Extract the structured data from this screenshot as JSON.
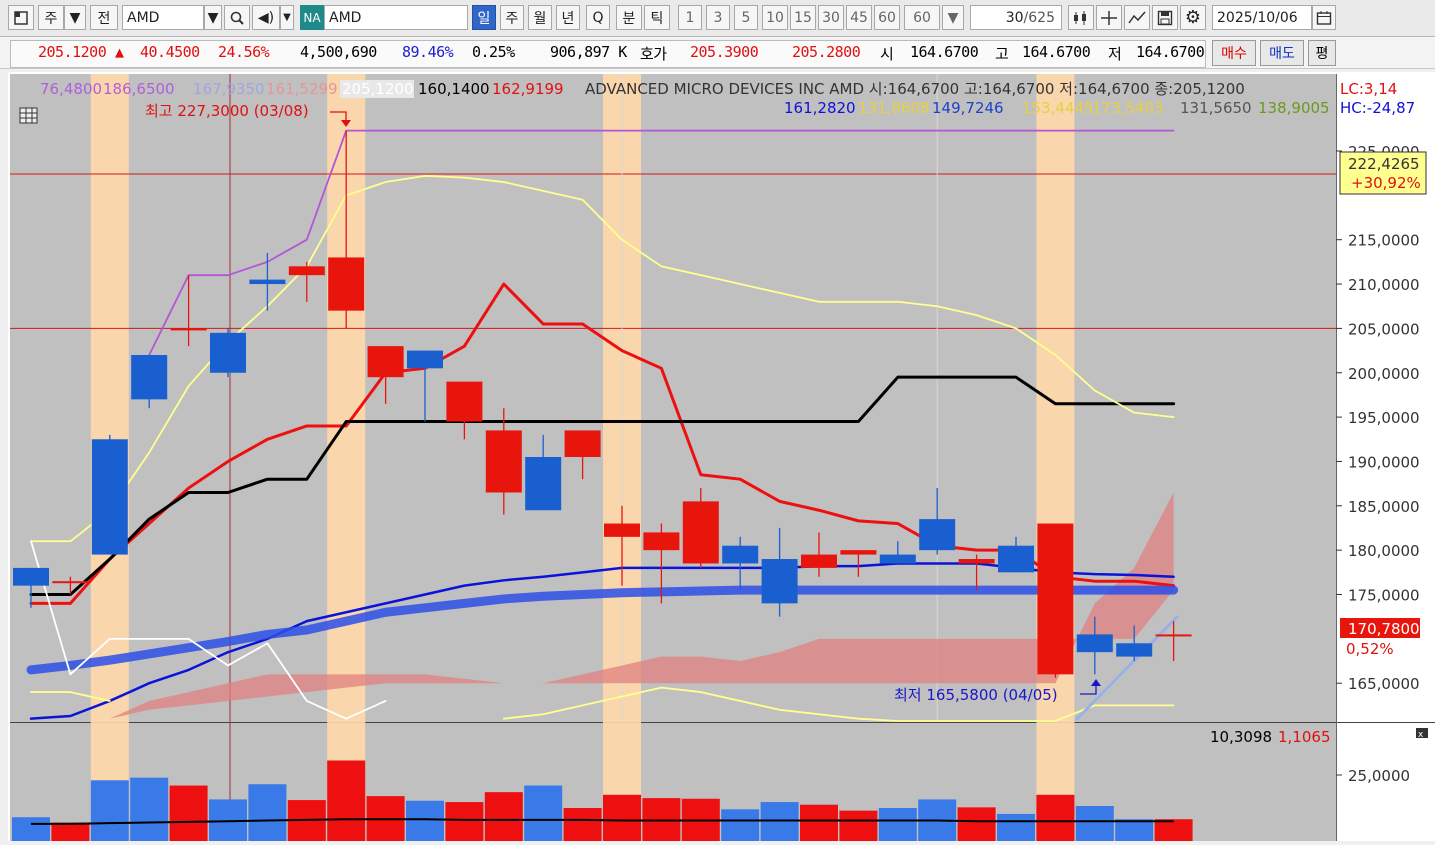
{
  "toolbar": {
    "period_label": "주",
    "prev_label": "전",
    "symbol_value": "AMD",
    "market_badge": "NA",
    "symbol_name": "AMD",
    "periods": [
      "일",
      "주",
      "월",
      "년",
      "Q"
    ],
    "active_period": "일",
    "intraday": [
      "분",
      "틱"
    ],
    "intervals": [
      "1",
      "3",
      "5",
      "10",
      "15",
      "30",
      "45",
      "60",
      "60"
    ],
    "count_value": "30",
    "count_total": "/625",
    "date_value": "2025/10/06",
    "icons": [
      "window-icon",
      "dropdown-icon",
      "search-icon",
      "speaker-icon",
      "candle-icon",
      "crosshair-icon",
      "line-tool-icon",
      "save-icon",
      "gear-icon",
      "calendar-icon"
    ]
  },
  "quote": {
    "price": "205.1200",
    "change_arrow": "▲",
    "change": "40.4500",
    "change_pct": "24.56%",
    "volume": "4,500,690",
    "volume_ratio": "89.46%",
    "turnover": "0.25%",
    "amount": "906,897 K",
    "bid_label": "호가",
    "ask_price": "205.3900",
    "bid_price": "205.2800",
    "open_label": "시",
    "open": "164.6700",
    "high_label": "고",
    "high": "164.6700",
    "low_label": "저",
    "low": "164.6700",
    "buy_label": "매수",
    "sell_label": "매도",
    "flat_label": "평"
  },
  "legend": {
    "row1": [
      "76,4800",
      "186,6500",
      "167,9350",
      "161,5299",
      "205,1200",
      "160,1400",
      "162,9199"
    ],
    "title": "ADVANCED MICRO DEVICES INC  AMD 시:164,6700 고:164,6700 저:164,6700 종:205,1200",
    "row2": [
      "161,2820",
      "131,8608",
      "149,7246",
      "153,4445",
      "173,5403",
      "131,5650",
      "138,9005"
    ],
    "lc": "LC:3,14",
    "hc": "HC:-24,87"
  },
  "annotations": {
    "max_label": "최고 227,3000 (03/08)",
    "min_label": "최저 165,5800 (04/05)",
    "top_box_value": "222,4265",
    "top_box_pct": "+30,92%",
    "current_value": "170,7800",
    "current_pct": "0,52%",
    "volume_values": [
      "10,3098",
      "1,1065"
    ]
  },
  "colors": {
    "up": "#e8150c",
    "down": "#1a5fd0",
    "highlight": "#ffd8a8",
    "ma_red": "#ee1010",
    "ma_black": "#000000",
    "ma_blue": "#0a14d8",
    "ma_yellow": "#ffff90",
    "ma_purple": "#b455d8",
    "cloud": "#e08080",
    "background": "#c0c0c0"
  },
  "chart_data": {
    "type": "candlestick",
    "ylim": [
      161,
      232
    ],
    "price_ticks": [
      "225,0000",
      "215,0000",
      "210,0000",
      "205,0000",
      "200,0000",
      "195,0000",
      "190,0000",
      "185,0000",
      "180,0000",
      "175,0000",
      "165,0000"
    ],
    "volume_ticks": [
      "25,0000"
    ],
    "hlines": [
      205.0,
      222.4
    ],
    "highlight_bars": [
      2,
      8,
      15,
      26
    ],
    "candles": [
      {
        "o": 178.0,
        "h": 178.0,
        "l": 173.5,
        "c": 176.0
      },
      {
        "o": 176.5,
        "h": 177.0,
        "l": 175.0,
        "c": 176.5
      },
      {
        "o": 192.5,
        "h": 193.0,
        "l": 179.5,
        "c": 179.5
      },
      {
        "o": 202.0,
        "h": 202.0,
        "l": 196.0,
        "c": 197.0
      },
      {
        "o": 205.0,
        "h": 211.0,
        "l": 203.0,
        "c": 205.0
      },
      {
        "o": 204.5,
        "h": 205.0,
        "l": 199.5,
        "c": 200.0
      },
      {
        "o": 210.5,
        "h": 213.5,
        "l": 207.0,
        "c": 210.0
      },
      {
        "o": 211.0,
        "h": 212.5,
        "l": 208.0,
        "c": 212.0
      },
      {
        "o": 207.0,
        "h": 227.3,
        "l": 205.0,
        "c": 213.0
      },
      {
        "o": 199.5,
        "h": 203.0,
        "l": 196.5,
        "c": 203.0
      },
      {
        "o": 202.5,
        "h": 202.5,
        "l": 194.5,
        "c": 200.5
      },
      {
        "o": 194.5,
        "h": 199.0,
        "l": 192.5,
        "c": 199.0
      },
      {
        "o": 186.5,
        "h": 196.0,
        "l": 184.0,
        "c": 193.5
      },
      {
        "o": 190.5,
        "h": 193.0,
        "l": 184.5,
        "c": 184.5
      },
      {
        "o": 190.5,
        "h": 193.0,
        "l": 188.0,
        "c": 193.5
      },
      {
        "o": 181.5,
        "h": 185.0,
        "l": 176.0,
        "c": 183.0
      },
      {
        "o": 180.0,
        "h": 183.0,
        "l": 174.0,
        "c": 182.0
      },
      {
        "o": 178.5,
        "h": 187.0,
        "l": 178.0,
        "c": 185.5
      },
      {
        "o": 180.5,
        "h": 181.5,
        "l": 175.5,
        "c": 178.5
      },
      {
        "o": 179.0,
        "h": 182.5,
        "l": 172.5,
        "c": 174.0
      },
      {
        "o": 178.0,
        "h": 182.0,
        "l": 177.0,
        "c": 179.5
      },
      {
        "o": 179.5,
        "h": 180.0,
        "l": 177.0,
        "c": 180.0
      },
      {
        "o": 179.5,
        "h": 181.0,
        "l": 178.5,
        "c": 178.5
      },
      {
        "o": 183.5,
        "h": 187.0,
        "l": 179.5,
        "c": 180.0
      },
      {
        "o": 178.5,
        "h": 179.5,
        "l": 175.5,
        "c": 179.0
      },
      {
        "o": 180.5,
        "h": 181.5,
        "l": 177.5,
        "c": 177.5
      },
      {
        "o": 166.0,
        "h": 183.0,
        "l": 165.6,
        "c": 183.0
      },
      {
        "o": 170.5,
        "h": 172.5,
        "l": 166.0,
        "c": 168.5
      },
      {
        "o": 169.5,
        "h": 171.5,
        "l": 167.5,
        "c": 168.0
      },
      {
        "o": 170.5,
        "h": 172.0,
        "l": 167.5,
        "c": 170.5
      }
    ],
    "volume": [
      3.6,
      2.8,
      9.2,
      9.6,
      8.4,
      6.3,
      8.6,
      6.2,
      12.2,
      6.8,
      6.1,
      5.9,
      7.4,
      8.4,
      5.0,
      7.0,
      6.5,
      6.4,
      4.8,
      5.9,
      5.5,
      4.6,
      5.0,
      6.3,
      5.1,
      4.1,
      7.0,
      5.3,
      3.3,
      3.3
    ],
    "volume_ylim": [
      0,
      15
    ],
    "series": [
      {
        "name": "MA-red",
        "color": "#ee1010",
        "values": [
          174,
          174,
          179,
          183,
          187,
          190,
          192.5,
          194,
          194,
          200,
          200.5,
          203,
          210,
          205.5,
          205.5,
          202.5,
          200.5,
          188.5,
          188,
          185.5,
          184.5,
          183.3,
          183,
          180.5,
          180,
          180,
          177,
          176.5,
          176.5,
          176
        ]
      },
      {
        "name": "MA-black",
        "color": "#000000",
        "values": [
          175,
          175,
          179,
          183.5,
          186.5,
          186.5,
          188,
          188,
          194.5,
          194.5,
          194.5,
          194.5,
          194.5,
          194.5,
          194.5,
          194.5,
          194.5,
          194.5,
          194.5,
          194.5,
          194.5,
          194.5,
          199.5,
          199.5,
          199.5,
          199.5,
          196.5,
          196.5,
          196.5,
          196.5
        ]
      },
      {
        "name": "MA-yellow",
        "color": "#ffff90",
        "values": [
          181,
          181,
          184.5,
          191,
          198.5,
          203.5,
          207.5,
          212,
          220,
          221.5,
          222.2,
          222,
          221.5,
          220.5,
          219.5,
          215,
          212,
          211,
          210,
          209,
          208,
          208,
          208,
          207.5,
          206.5,
          205,
          202,
          198,
          195.5,
          195
        ]
      },
      {
        "name": "MA-purple",
        "color": "#b455d8",
        "values": [
          null,
          null,
          null,
          202,
          211,
          211,
          212.5,
          215,
          227.3,
          227.3,
          227.3,
          227.3,
          227.3,
          227.3,
          227.3,
          227.3,
          227.3,
          227.3,
          227.3,
          227.3,
          227.3,
          227.3,
          227.3,
          227.3,
          227.3,
          227.3,
          227.3,
          227.3,
          227.3,
          227.3
        ]
      },
      {
        "name": "MA-blue",
        "color": "#0a14d8",
        "values": [
          161,
          161.3,
          163,
          165,
          166.5,
          168.5,
          170,
          172,
          173,
          174,
          175,
          176,
          176.6,
          177,
          177.5,
          178,
          178,
          178,
          178,
          178,
          178.2,
          178.2,
          178.5,
          178.5,
          178.5,
          178,
          177.5,
          177.3,
          177.2,
          177
        ]
      },
      {
        "name": "MA-thick-blue",
        "color": "#2d4fe6",
        "values": [
          166.5,
          167,
          167.6,
          168.3,
          169,
          169.7,
          170.5,
          171,
          172,
          173,
          173.5,
          174,
          174.5,
          174.8,
          175,
          175.2,
          175.3,
          175.4,
          175.5,
          175.5,
          175.5,
          175.5,
          175.5,
          175.5,
          175.5,
          175.5,
          175.5,
          175.5,
          175.5,
          175.5
        ]
      },
      {
        "name": "MA-white",
        "color": "#ffffff",
        "values": [
          181,
          166,
          170,
          170,
          170,
          167,
          169.5,
          163,
          161,
          163,
          null,
          null,
          null,
          null,
          null,
          null,
          null,
          null,
          null,
          null,
          null,
          null,
          null,
          null,
          null,
          null,
          null,
          null,
          null,
          null
        ]
      },
      {
        "name": "MA-lightyellow",
        "color": "#ffff90",
        "values": [
          164,
          164,
          163,
          null,
          null,
          null,
          null,
          null,
          null,
          null,
          null,
          null,
          161,
          161.5,
          162.5,
          163.5,
          164.5,
          164,
          163,
          162,
          161.5,
          161,
          160,
          160,
          160,
          160,
          160,
          162.5,
          162.5,
          162.5
        ]
      }
    ],
    "cloud": {
      "upper": [
        161,
        161,
        161,
        163,
        164,
        165,
        166,
        166,
        166,
        166,
        166,
        165.5,
        165,
        165,
        166,
        167,
        168,
        168,
        167.5,
        168.5,
        170,
        170,
        170,
        170,
        170,
        170,
        170,
        170,
        170,
        175.5
      ],
      "lower": [
        161,
        161,
        161,
        162,
        162.5,
        163,
        163.5,
        164,
        164.5,
        165,
        165,
        165,
        165,
        165,
        165,
        165,
        165,
        165,
        165,
        165,
        165,
        165,
        165,
        165,
        165,
        165,
        165,
        174,
        178,
        186.5
      ]
    },
    "volume_ma": [
      2.6,
      2.6,
      2.7,
      2.8,
      2.9,
      3.0,
      3.1,
      3.2,
      3.3,
      3.3,
      3.3,
      3.2,
      3.2,
      3.2,
      3.2,
      3.1,
      3.1,
      3.1,
      3.1,
      3.1,
      3.1,
      3.1,
      3.1,
      3.1,
      3.0,
      3.0,
      3.0,
      3.0,
      3.0,
      3.0
    ]
  }
}
